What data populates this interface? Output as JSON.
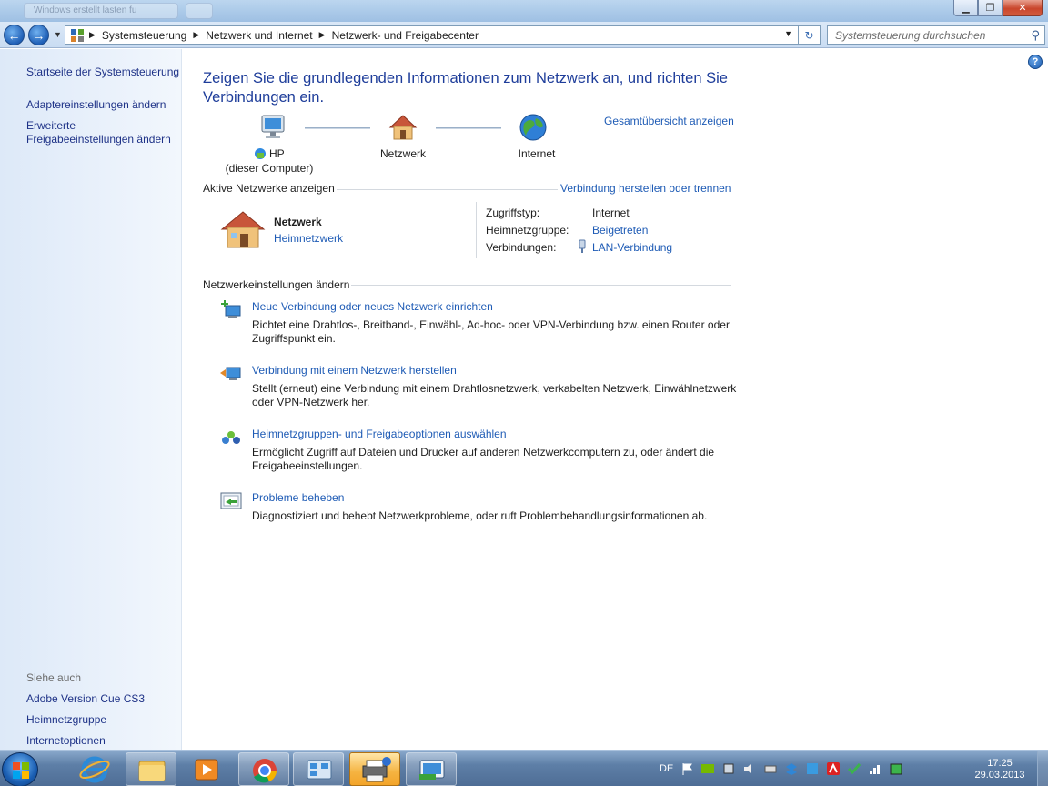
{
  "window": {
    "tab_title": "Windows erstellt lasten fu"
  },
  "address_bar": {
    "crumbs": [
      "Systemsteuerung",
      "Netzwerk und Internet",
      "Netzwerk- und Freigabecenter"
    ],
    "search_placeholder": "Systemsteuerung durchsuchen"
  },
  "sidebar": {
    "links": [
      "Startseite der Systemsteuerung",
      "Adaptereinstellungen ändern",
      "Erweiterte",
      "Freigabeeinstellungen ändern"
    ],
    "see_also_label": "Siehe auch",
    "see_also": [
      "Adobe Version Cue CS3",
      "Heimnetzgruppe",
      "Internetoptionen"
    ]
  },
  "main": {
    "heading_line1": "Zeigen Sie die grundlegenden Informationen zum Netzwerk an, und richten Sie",
    "heading_line2": "Verbindungen ein.",
    "map": {
      "computer_name": "HP",
      "computer_sub": "(dieser Computer)",
      "network": "Netzwerk",
      "internet": "Internet",
      "overview_link": "Gesamtübersicht anzeigen"
    },
    "active_networks": {
      "title": "Aktive Netzwerke anzeigen",
      "connect_link": "Verbindung herstellen oder trennen",
      "network_name": "Netzwerk",
      "network_type": "Heimnetzwerk",
      "access_label": "Zugriffstyp:",
      "access_value": "Internet",
      "homegroup_label": "Heimnetzgruppe:",
      "homegroup_value": "Beigetreten",
      "connections_label": "Verbindungen:",
      "connections_value": "LAN-Verbindung"
    },
    "settings": {
      "title": "Netzwerkeinstellungen ändern",
      "tasks": [
        {
          "title": "Neue Verbindung oder neues Netzwerk einrichten",
          "desc1": "Richtet eine Drahtlos-, Breitband-, Einwähl-, Ad-hoc- oder VPN-Verbindung bzw. einen Router oder",
          "desc2": "Zugriffspunkt ein."
        },
        {
          "title": "Verbindung mit einem Netzwerk herstellen",
          "desc1": "Stellt (erneut) eine Verbindung mit einem Drahtlosnetzwerk, verkabelten Netzwerk, Einwählnetzwerk",
          "desc2": "oder VPN-Netzwerk her."
        },
        {
          "title": "Heimnetzgruppen- und Freigabeoptionen auswählen",
          "desc1": "Ermöglicht Zugriff auf Dateien und Drucker auf anderen Netzwerkcomputern zu, oder ändert die",
          "desc2": "Freigabeeinstellungen."
        },
        {
          "title": "Probleme beheben",
          "desc1": "Diagnostiziert und behebt Netzwerkprobleme, oder ruft Problembehandlungsinformationen ab.",
          "desc2": ""
        }
      ]
    }
  },
  "taskbar": {
    "language": "DE",
    "time": "17:25",
    "date": "29.03.2013"
  },
  "colors": {
    "link": "#1e5bb5",
    "heading": "#1e3d9a",
    "sidebar_link": "#1e3287"
  }
}
